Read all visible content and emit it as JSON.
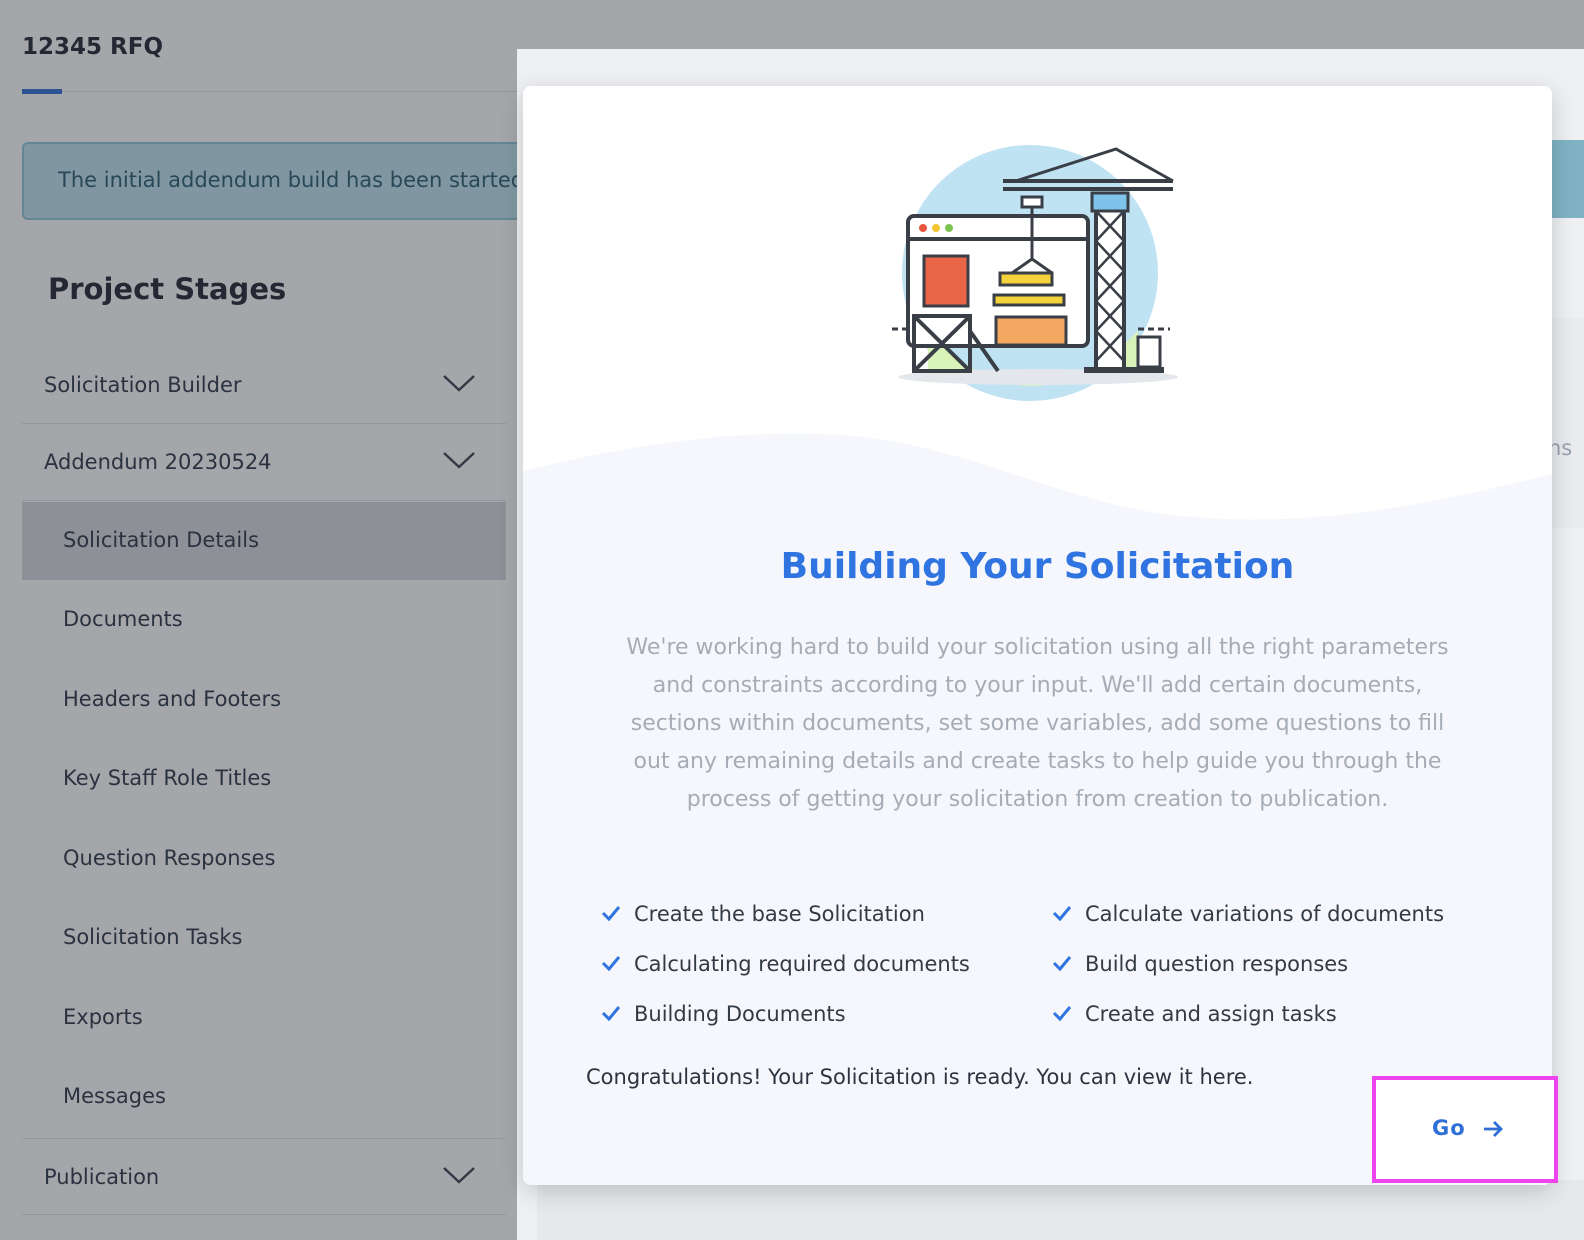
{
  "page": {
    "title": "12345 RFQ",
    "alert_text": "The initial addendum build has been started"
  },
  "stages": {
    "title": "Project Stages",
    "groups": [
      {
        "label": "Solicitation Builder"
      },
      {
        "label": "Addendum 20230524"
      }
    ],
    "sub_items": [
      {
        "label": "Solicitation Details",
        "active": true
      },
      {
        "label": "Documents"
      },
      {
        "label": "Headers and Footers"
      },
      {
        "label": "Key Staff Role Titles"
      },
      {
        "label": "Question Responses"
      },
      {
        "label": "Solicitation Tasks"
      },
      {
        "label": "Exports"
      },
      {
        "label": "Messages"
      }
    ],
    "publication_label": "Publication"
  },
  "modal": {
    "title": "Building Your Solicitation",
    "description": "We're working hard to build your solicitation using all the right parameters and constraints according to your input. We'll add certain documents, sections within documents, set some variables, add some questions to fill out any remaining details and create tasks to help guide you through the process of getting your solicitation from creation to publication.",
    "checklist_left": [
      "Create the base Solicitation",
      "Calculating required documents",
      "Building Documents"
    ],
    "checklist_right": [
      "Calculate variations of documents",
      "Build question responses",
      "Create and assign tasks"
    ],
    "congrats": "Congratulations! Your Solicitation is ready. You can view it here.",
    "go_label": "Go"
  },
  "side_text": "ns",
  "colors": {
    "accent": "#2f74e0",
    "highlight_border": "#ee44ee",
    "alert_bg": "#bfe6f0"
  }
}
